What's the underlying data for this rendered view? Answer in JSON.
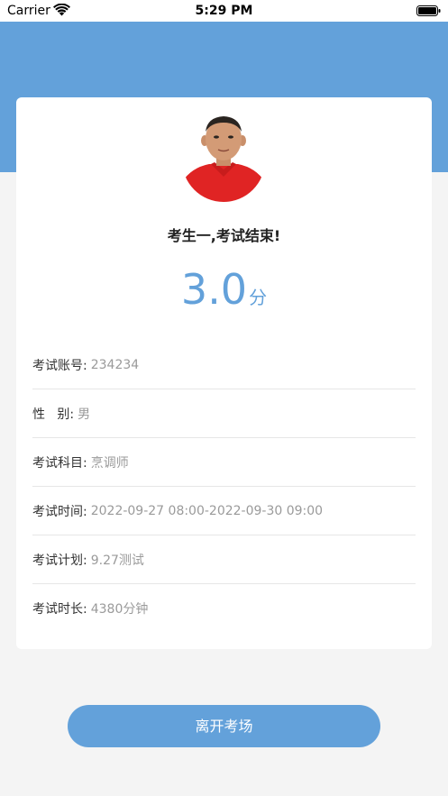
{
  "status_bar": {
    "carrier": "Carrier",
    "time": "5:29 PM"
  },
  "result": {
    "title": "考生一,考试结束!",
    "score": "3.0",
    "score_unit": "分"
  },
  "info": [
    {
      "label": "考试账号:",
      "value": "234234"
    },
    {
      "label": "性   别:",
      "value": "男"
    },
    {
      "label": "考试科目:",
      "value": "烹调师"
    },
    {
      "label": "考试时间:",
      "value": "2022-09-27 08:00-2022-09-30 09:00"
    },
    {
      "label": "考试计划:",
      "value": "9.27测试"
    },
    {
      "label": "考试时长:",
      "value": "4380分钟"
    }
  ],
  "actions": {
    "leave_label": "离开考场"
  },
  "colors": {
    "accent": "#63a1da",
    "background": "#f4f4f4"
  },
  "icons": {
    "wifi": "wifi-icon",
    "battery": "battery-icon"
  }
}
